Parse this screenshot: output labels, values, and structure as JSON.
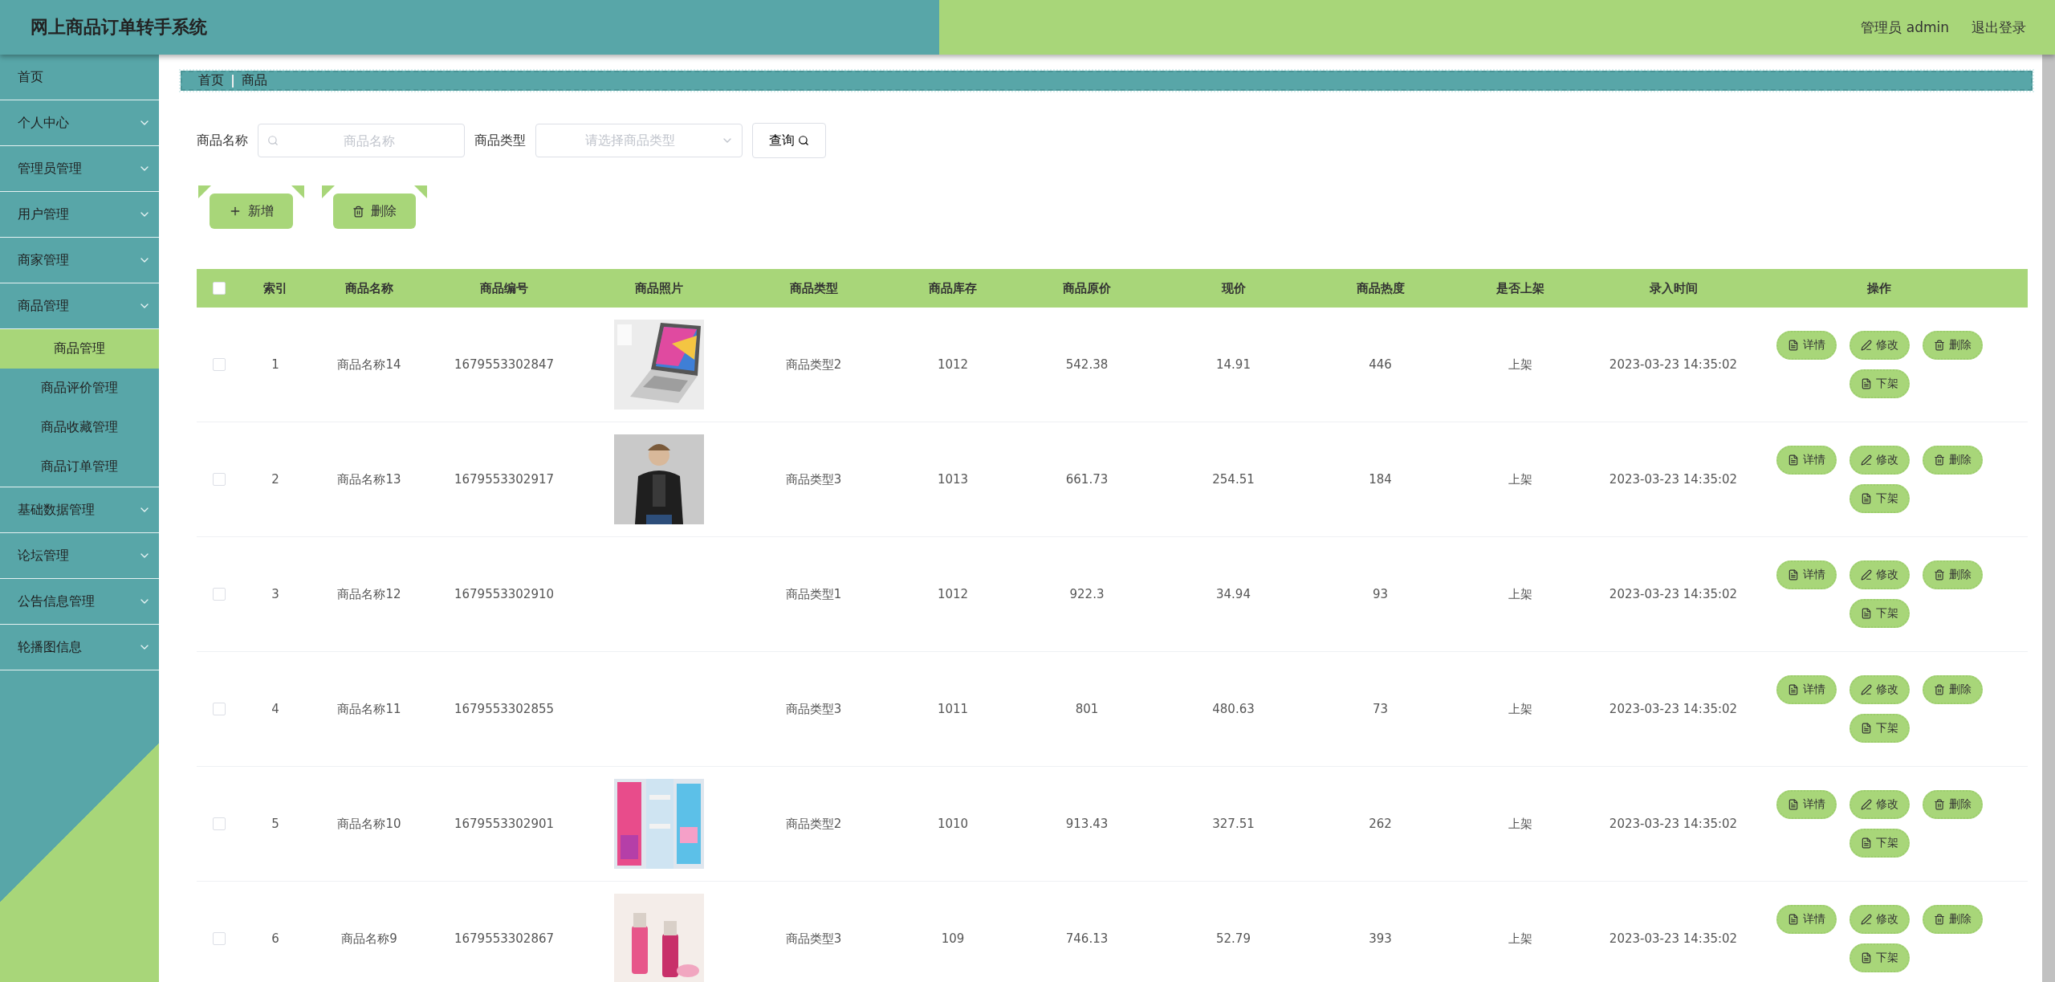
{
  "header": {
    "title": "网上商品订单转手系统",
    "user": "管理员 admin",
    "logout": "退出登录"
  },
  "sidebar": {
    "items": [
      {
        "label": "首页"
      },
      {
        "label": "个人中心"
      },
      {
        "label": "管理员管理"
      },
      {
        "label": "用户管理"
      },
      {
        "label": "商家管理"
      },
      {
        "label": "商品管理",
        "children": [
          {
            "label": "商品管理",
            "selected": true
          },
          {
            "label": "商品评价管理",
            "selected": false
          },
          {
            "label": "商品收藏管理",
            "selected": false
          },
          {
            "label": "商品订单管理",
            "selected": false
          }
        ]
      },
      {
        "label": "基础数据管理"
      },
      {
        "label": "论坛管理"
      },
      {
        "label": "公告信息管理"
      },
      {
        "label": "轮播图信息"
      }
    ]
  },
  "breadcrumb": [
    "首页",
    "商品"
  ],
  "search": {
    "name_label": "商品名称",
    "name_placeholder": "商品名称",
    "type_label": "商品类型",
    "type_placeholder": "请选择商品类型",
    "button": "查询"
  },
  "actions": {
    "add": "新增",
    "delete": "删除"
  },
  "table": {
    "columns": [
      "索引",
      "商品名称",
      "商品编号",
      "商品照片",
      "商品类型",
      "商品库存",
      "商品原价",
      "现价",
      "商品热度",
      "是否上架",
      "录入时间",
      "操作"
    ],
    "all_checked": false,
    "rows": [
      {
        "checked": false,
        "index": "1",
        "name": "商品名称14",
        "code": "1679553302847",
        "type": "商品类型2",
        "stock": "1012",
        "price": "542.38",
        "now": "14.91",
        "heat": "446",
        "on_sale": "上架",
        "time": "2023-03-23 14:35:02",
        "actions": [
          "详情",
          "修改",
          "删除",
          "下架"
        ]
      },
      {
        "checked": false,
        "index": "2",
        "name": "商品名称13",
        "code": "1679553302917",
        "type": "商品类型3",
        "stock": "1013",
        "price": "661.73",
        "now": "254.51",
        "heat": "184",
        "on_sale": "上架",
        "time": "2023-03-23 14:35:02",
        "actions": [
          "详情",
          "修改",
          "删除",
          "下架"
        ]
      },
      {
        "checked": false,
        "index": "3",
        "name": "商品名称12",
        "code": "1679553302910",
        "type": "商品类型1",
        "stock": "1012",
        "price": "922.3",
        "now": "34.94",
        "heat": "93",
        "on_sale": "上架",
        "time": "2023-03-23 14:35:02",
        "actions": [
          "详情",
          "修改",
          "删除",
          "下架"
        ]
      },
      {
        "checked": false,
        "index": "4",
        "name": "商品名称11",
        "code": "1679553302855",
        "type": "商品类型3",
        "stock": "1011",
        "price": "801",
        "now": "480.63",
        "heat": "73",
        "on_sale": "上架",
        "time": "2023-03-23 14:35:02",
        "actions": [
          "详情",
          "修改",
          "删除",
          "下架"
        ]
      },
      {
        "checked": false,
        "index": "5",
        "name": "商品名称10",
        "code": "1679553302901",
        "type": "商品类型2",
        "stock": "1010",
        "price": "913.43",
        "now": "327.51",
        "heat": "262",
        "on_sale": "上架",
        "time": "2023-03-23 14:35:02",
        "actions": [
          "详情",
          "修改",
          "删除",
          "下架"
        ]
      },
      {
        "checked": false,
        "index": "6",
        "name": "商品名称9",
        "code": "1679553302867",
        "type": "商品类型3",
        "stock": "109",
        "price": "746.13",
        "now": "52.79",
        "heat": "393",
        "on_sale": "上架",
        "time": "2023-03-23 14:35:02",
        "actions": [
          "详情",
          "修改",
          "删除",
          "下架"
        ]
      }
    ]
  }
}
